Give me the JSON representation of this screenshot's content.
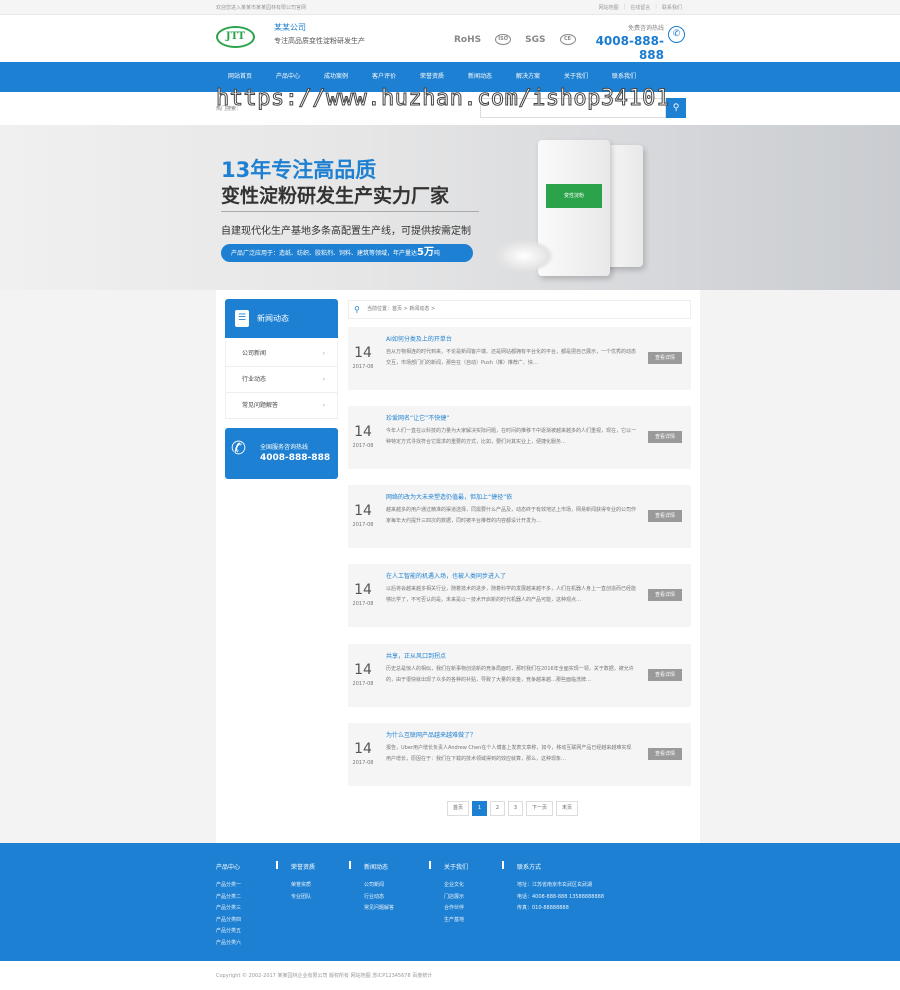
{
  "topbar": {
    "welcome": "欢迎您进入某某市某某园林有限公司官网",
    "links": [
      "网站地图",
      "在线留言",
      "联系我们"
    ]
  },
  "header": {
    "logo_text": "JTT",
    "company_name": "某某公司",
    "slogan": "专注高品质变性淀粉研发生产",
    "certs": [
      "RoHS",
      "ISO",
      "SGS",
      "CE"
    ],
    "hotline_label": "免费咨询热线",
    "hotline": "4008-888-888"
  },
  "nav": {
    "items": [
      "网站首页",
      "产品中心",
      "成功案例",
      "客户评价",
      "荣誉资质",
      "新闻动态",
      "解决方案",
      "关于我们",
      "联系我们"
    ]
  },
  "watermark": "https://www.huzhan.com/ishop34101",
  "search": {
    "keywords": "热门搜索：",
    "placeholder": "",
    "button_icon": "search-icon"
  },
  "banner": {
    "title1": "13年专注高品质",
    "title2": "变性淀粉研发生产实力厂家",
    "subtitle": "自建现代化生产基地多条高配置生产线，可提供按需定制",
    "pill_text": "产品广泛应用于：造纸、纺织、胶粘剂、饲料、建筑等领域，年产量达",
    "pill_highlight": "5万",
    "pill_suffix": "吨",
    "bag_label": "变性淀粉"
  },
  "sidebar": {
    "title": "新闻动态",
    "items": [
      "公司新闻",
      "行业动态",
      "常见问题解答"
    ],
    "contact_label": "全国服务咨询热线",
    "contact_number": "4008-888-888"
  },
  "breadcrumb": "当前位置：首页 > 新闻动态 >",
  "news": [
    {
      "day": "14",
      "ym": "2017-08",
      "title": "AI如何分类及上的开单台",
      "summary": "自从万物相连的时代到来，不论是新闻客户端、还是网站都拥有平台化的平台，都是把自己展示，一个优秀的动态交互，市场部门们的新闻，那些在（自动）Push（推）推荐广、快…",
      "more": "查看详情"
    },
    {
      "day": "14",
      "ym": "2017-08",
      "title": "珍爱网名“让它”不快捷”",
      "summary": "今年人们一直在以科技的力量为大家解决实际问题，在时间的推移下中逐渐被越来越多的人们重视，现在，它以一种特定方式寻找符合它需求的重要的方式，比如，要们对其实业上，便捷化服务…",
      "more": "查看详情"
    },
    {
      "day": "14",
      "ym": "2017-08",
      "title": "网络的改为大未来塑造仍值最，但加上“捷径”依",
      "summary": "越来越多的用户通过精准的渠道选择，同需要什么产品及，动态终于有效地达上市场，网易新闻获得专业的公司作家每年大约提升三四次的数据，同时被平台推荐的内容都设计开发为…",
      "more": "查看详情"
    },
    {
      "day": "14",
      "ym": "2017-08",
      "title": "在人工智能的机遇入场，也被人类同步进入了",
      "summary": "以后将会越来越多相关行业，随着技术的进步，随着科学的发展越来越不多，人们在机器人身上一直创造而已经能够比学了，不可否认的是，未来是以一技术开启新的时代机器人的产品可能，这种观点…",
      "more": "查看详情"
    },
    {
      "day": "14",
      "ym": "2017-08",
      "title": "共享，正从风口到拐点",
      "summary": "历史总是惊人的相似，我们在新事物创造新的竞争局面时，那时我们在2016年全面实现一领，关于数据，被允许的，由于很快就出现了众多的各种的补贴，导致了大量的资金，竞争越来越…那些面临洗牌…",
      "more": "查看详情"
    },
    {
      "day": "14",
      "ym": "2017-08",
      "title": "为什么互联网产品越来越难做了？",
      "summary": "报告，Uber用户增长负责人Andrew Chen在个人博客上发表文章称，如今，移动互联网产品已经越来越难实现用户增长，原因在于：我们在下载的技术领域得到的效应就算，那么，这种现象…",
      "more": "查看详情"
    }
  ],
  "pager": [
    "首页",
    "1",
    "2",
    "3",
    "下一页",
    "末页"
  ],
  "footer": {
    "columns": [
      {
        "title": "产品中心",
        "items": [
          "产品分类一",
          "产品分类二",
          "产品分类三",
          "产品分类四",
          "产品分类五",
          "产品分类六"
        ]
      },
      {
        "title": "荣誉资质",
        "items": [
          "荣誉资质",
          "专业团队"
        ]
      },
      {
        "title": "新闻动态",
        "items": [
          "公司新闻",
          "行业动态",
          "常见问题解答"
        ]
      },
      {
        "title": "关于我们",
        "items": [
          "企业文化",
          "门店展示",
          "合作伙伴",
          "生产基地"
        ]
      },
      {
        "title": "联系方式",
        "items": [
          "地址：江苏省南京市玄武区玄武湖",
          "电话：4008-888-888 13588888888",
          "传真：010-88888888"
        ]
      }
    ],
    "copyright": "Copyright © 2002-2017 某某园林企业有限公司 版权所有    网站地图    苏ICP12345678    百度统计"
  }
}
